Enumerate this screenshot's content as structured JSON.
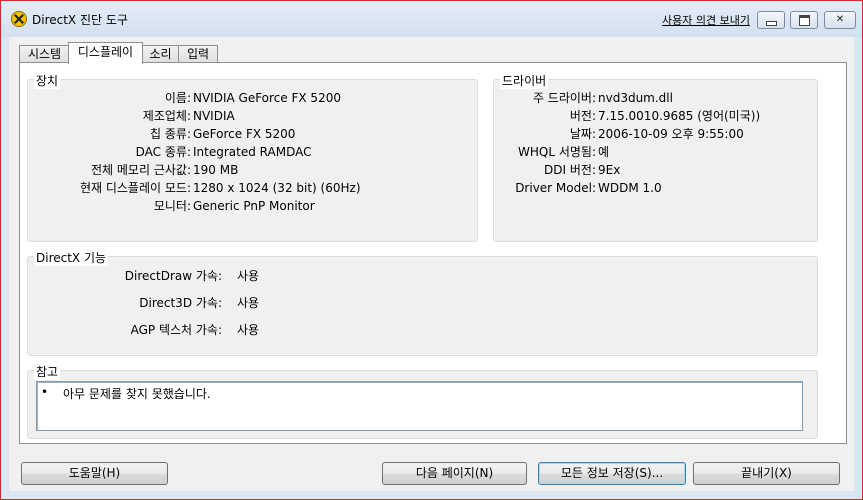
{
  "window": {
    "title": "DirectX 진단 도구",
    "help_link": "사용자 의견 보내기"
  },
  "tabs": [
    {
      "label": "시스템"
    },
    {
      "label": "디스플레이",
      "active": true
    },
    {
      "label": "소리"
    },
    {
      "label": "입력"
    }
  ],
  "device": {
    "legend": "장치",
    "rows": [
      {
        "label": "이름:",
        "value": "NVIDIA GeForce FX 5200"
      },
      {
        "label": "제조업체:",
        "value": "NVIDIA"
      },
      {
        "label": "칩 종류:",
        "value": "GeForce FX 5200"
      },
      {
        "label": "DAC 종류:",
        "value": "Integrated RAMDAC"
      },
      {
        "label": "전체 메모리 근사값:",
        "value": "190 MB"
      },
      {
        "label": "현재 디스플레이 모드:",
        "value": "1280 x 1024 (32 bit) (60Hz)"
      },
      {
        "label": "모니터:",
        "value": "Generic PnP Monitor"
      }
    ]
  },
  "driver": {
    "legend": "드라이버",
    "rows": [
      {
        "label": "주 드라이버:",
        "value": "nvd3dum.dll"
      },
      {
        "label": "버전:",
        "value": "7.15.0010.9685 (영어(미국))"
      },
      {
        "label": "날짜:",
        "value": "2006-10-09 오후 9:55:00"
      },
      {
        "label": "WHQL 서명됨:",
        "value": "예"
      },
      {
        "label": "DDI 버전:",
        "value": "9Ex"
      },
      {
        "label": "Driver Model:",
        "value": "WDDM 1.0"
      }
    ]
  },
  "features": {
    "legend": "DirectX 기능",
    "rows": [
      {
        "label": "DirectDraw 가속:",
        "value": "사용"
      },
      {
        "label": "Direct3D 가속:",
        "value": "사용"
      },
      {
        "label": "AGP 텍스처 가속:",
        "value": "사용"
      }
    ]
  },
  "notes": {
    "legend": "참고",
    "bullet": "•",
    "items": [
      "아무 문제를 찾지 못했습니다."
    ]
  },
  "buttons": {
    "help": "도움말(H)",
    "next_page": "다음 페이지(N)",
    "save_all": "모든 정보 저장(S)...",
    "exit": "끝내기(X)"
  },
  "colors": {
    "frame_accent": "#d42a2a",
    "title_bg": "#dbe6f3",
    "focus_button": "#3c7fb1"
  }
}
